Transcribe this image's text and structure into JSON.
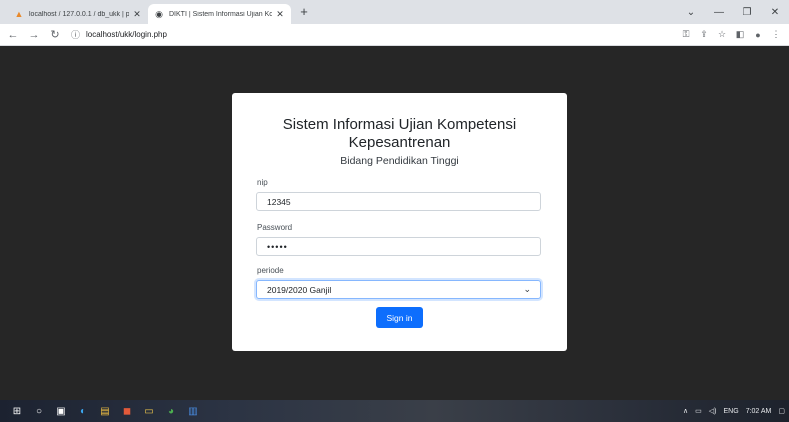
{
  "browser": {
    "tabs": [
      {
        "title": "localhost / 127.0.0.1 / db_ukk | p",
        "icon": "phpmyadmin-icon"
      },
      {
        "title": "DIKTI | Sistem Informasi Ujian Ko",
        "icon": "globe-icon"
      }
    ],
    "url": "localhost/ukk/login.php"
  },
  "login": {
    "title_line1": "Sistem Informasi Ujian Kompetensi",
    "title_line2": "Kepesantrenan",
    "subtitle": "Bidang Pendidikan Tinggi",
    "nip_label": "nip",
    "nip_value": "12345",
    "password_label": "Password",
    "password_value": "•••••",
    "periode_label": "periode",
    "periode_value": "2019/2020 Ganjil",
    "submit_label": "Sign in"
  },
  "taskbar": {
    "language": "ENG",
    "time": "7:02 AM"
  },
  "colors": {
    "page_background": "#262626",
    "primary_button": "#0d6efd"
  }
}
